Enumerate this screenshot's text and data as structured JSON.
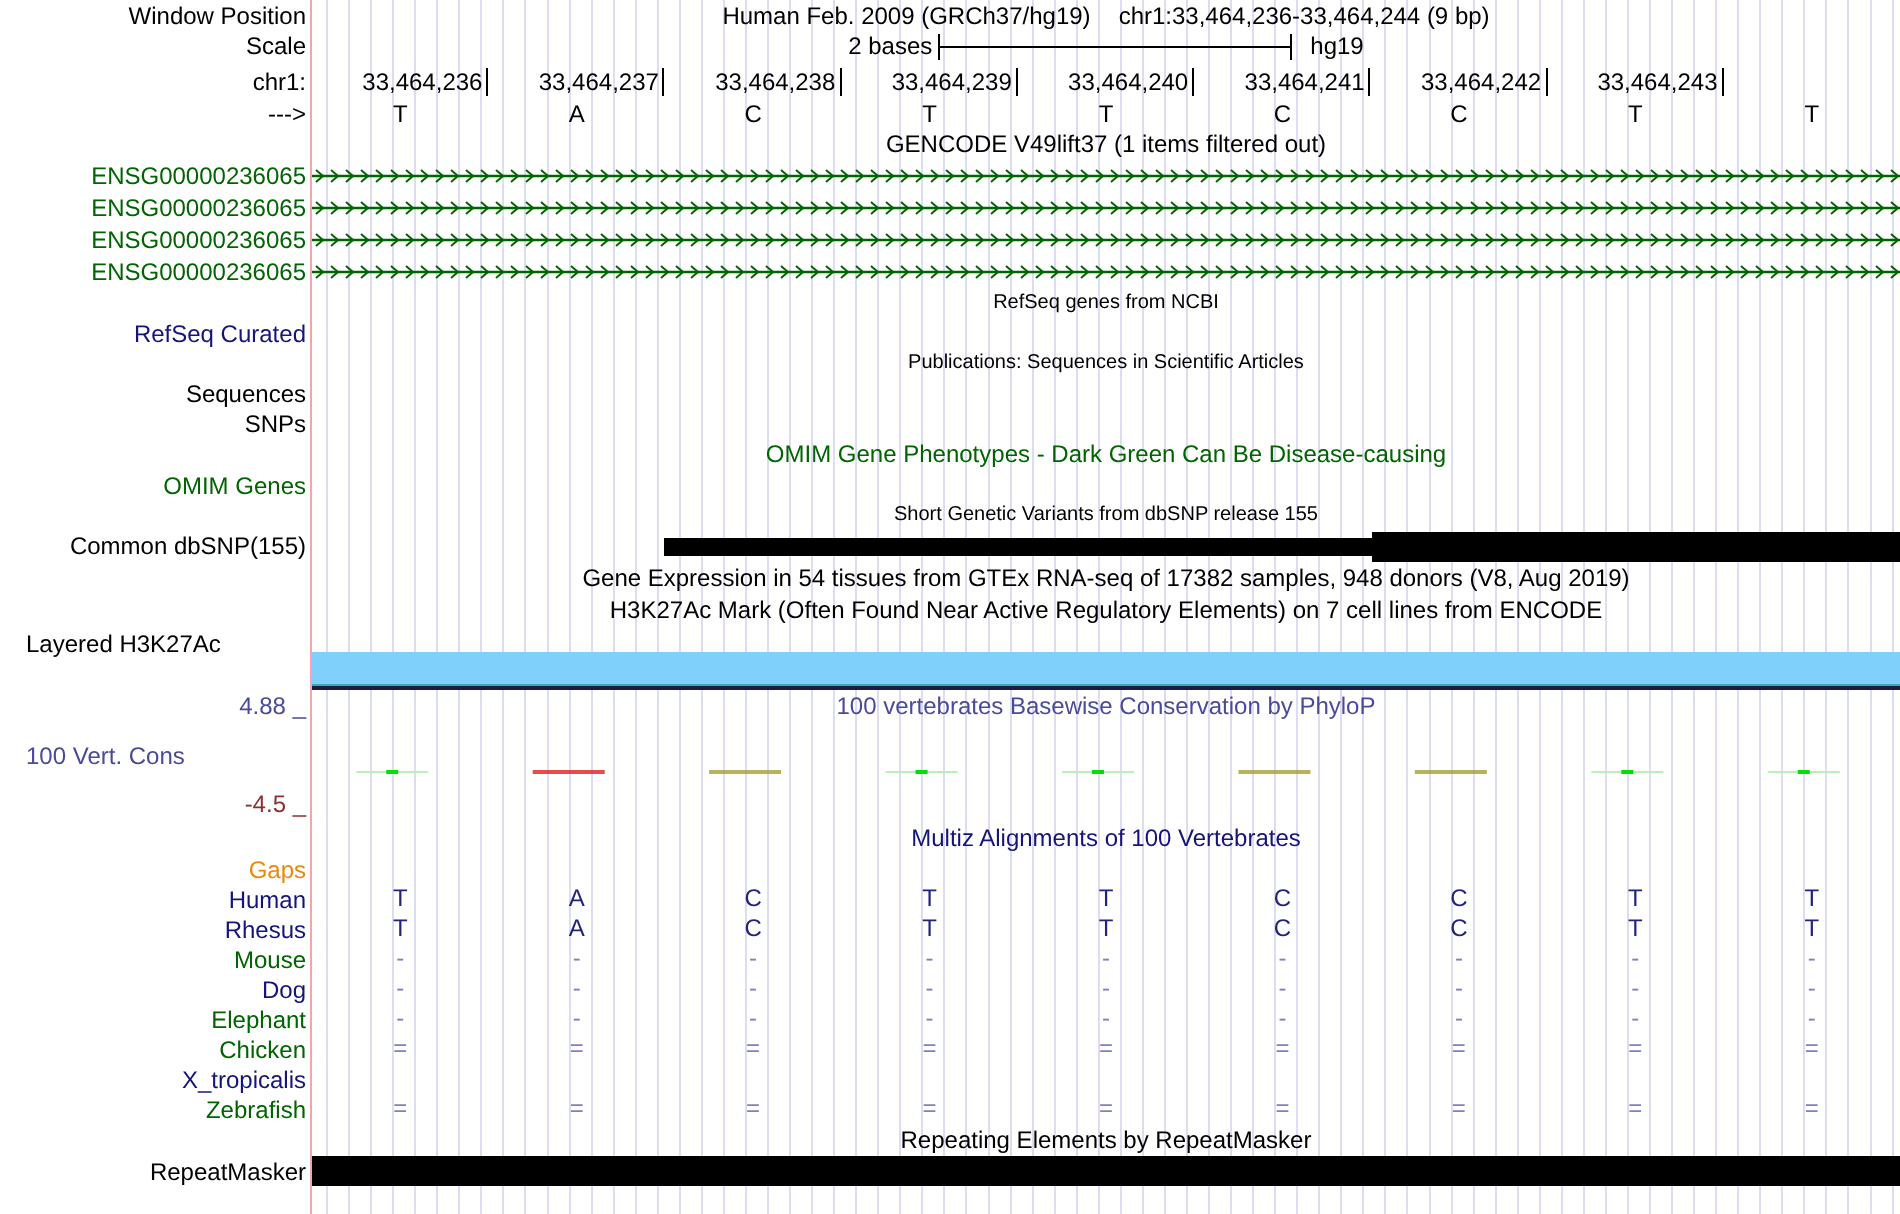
{
  "header": {
    "label": "Window Position",
    "assembly": "Human Feb. 2009 (GRCh37/hg19)",
    "position": "chr1:33,464,236-33,464,244 (9 bp)"
  },
  "scale": {
    "label": "Scale",
    "span": "2 bases",
    "db": "hg19"
  },
  "ruler": {
    "label": "chr1:",
    "ticks": [
      "33,464,236",
      "33,464,237",
      "33,464,238",
      "33,464,239",
      "33,464,240",
      "33,464,241",
      "33,464,242",
      "33,464,243"
    ]
  },
  "strand": {
    "label": "--->",
    "bases": [
      "T",
      "A",
      "C",
      "T",
      "T",
      "C",
      "C",
      "T",
      "T"
    ]
  },
  "tracks": [
    {
      "kind": "title",
      "text": "GENCODE V49lift37 (1 items filtered out)",
      "color": "#000000"
    },
    {
      "kind": "gene",
      "label": "ENSG00000236065",
      "color": "#006400"
    },
    {
      "kind": "gene",
      "label": "ENSG00000236065",
      "color": "#006400"
    },
    {
      "kind": "gene",
      "label": "ENSG00000236065",
      "color": "#006400"
    },
    {
      "kind": "gene",
      "label": "ENSG00000236065",
      "color": "#006400"
    },
    {
      "kind": "small_title",
      "text": "RefSeq genes from NCBI",
      "color": "#000000"
    },
    {
      "kind": "label",
      "label": "RefSeq Curated",
      "color": "#14147a"
    },
    {
      "kind": "small_title",
      "text": "Publications: Sequences in Scientific Articles",
      "color": "#000000"
    },
    {
      "kind": "label",
      "label": "Sequences",
      "color": "#000000"
    },
    {
      "kind": "label",
      "label": "SNPs",
      "color": "#000000"
    },
    {
      "kind": "title",
      "text": "OMIM Gene Phenotypes - Dark Green Can Be Disease-causing",
      "color": "#006400"
    },
    {
      "kind": "label",
      "label": "OMIM Genes",
      "color": "#006400"
    },
    {
      "kind": "small_title",
      "text": "Short Genetic Variants from dbSNP release 155",
      "color": "#000000"
    },
    {
      "kind": "snp",
      "label": "Common dbSNP(155)",
      "color": "#000000"
    },
    {
      "kind": "title",
      "text": "Gene Expression in 54 tissues from GTEx RNA-seq of 17382 samples, 948 donors (V8, Aug 2019)",
      "color": "#000000"
    },
    {
      "kind": "title",
      "text": "H3K27Ac Mark (Often Found Near Active Regulatory Elements) on 7 cell lines from ENCODE",
      "color": "#000000"
    },
    {
      "kind": "density",
      "label": "Layered H3K27Ac",
      "color": "#000000"
    },
    {
      "kind": "wiggle",
      "max": "4.88 _",
      "label": "100 Vert. Cons",
      "min": "-4.5 _",
      "title": "100 vertebrates Basewise Conservation by PhyloP",
      "color": "#4a4a9a"
    },
    {
      "kind": "title",
      "text": "Multiz Alignments of 100 Vertebrates",
      "color": "#14147a"
    },
    {
      "kind": "label",
      "label": "Gaps",
      "color": "#e8890c"
    },
    {
      "kind": "species",
      "label": "Human",
      "color": "#14147a",
      "bases": [
        "T",
        "A",
        "C",
        "T",
        "T",
        "C",
        "C",
        "T",
        "T"
      ]
    },
    {
      "kind": "species",
      "label": "Rhesus",
      "color": "#14147a",
      "bases": [
        "T",
        "A",
        "C",
        "T",
        "T",
        "C",
        "C",
        "T",
        "T"
      ]
    },
    {
      "kind": "species",
      "label": "Mouse",
      "color": "#006400",
      "bases": [
        "-",
        "-",
        "-",
        "-",
        "-",
        "-",
        "-",
        "-",
        "-"
      ]
    },
    {
      "kind": "species",
      "label": "Dog",
      "color": "#14147a",
      "bases": [
        "-",
        "-",
        "-",
        "-",
        "-",
        "-",
        "-",
        "-",
        "-"
      ]
    },
    {
      "kind": "species",
      "label": "Elephant",
      "color": "#006400",
      "bases": [
        "-",
        "-",
        "-",
        "-",
        "-",
        "-",
        "-",
        "-",
        "-"
      ]
    },
    {
      "kind": "species",
      "label": "Chicken",
      "color": "#006400",
      "bases": [
        "=",
        "=",
        "=",
        "=",
        "=",
        "=",
        "=",
        "=",
        "="
      ]
    },
    {
      "kind": "species",
      "label": "X_tropicalis",
      "color": "#14147a"
    },
    {
      "kind": "species",
      "label": "Zebrafish",
      "color": "#006400",
      "bases": [
        "=",
        "=",
        "=",
        "=",
        "=",
        "=",
        "=",
        "=",
        "="
      ]
    },
    {
      "kind": "title",
      "text": "Repeating Elements by RepeatMasker",
      "color": "#000000"
    },
    {
      "kind": "repeat",
      "label": "RepeatMasker",
      "color": "#000000"
    }
  ]
}
